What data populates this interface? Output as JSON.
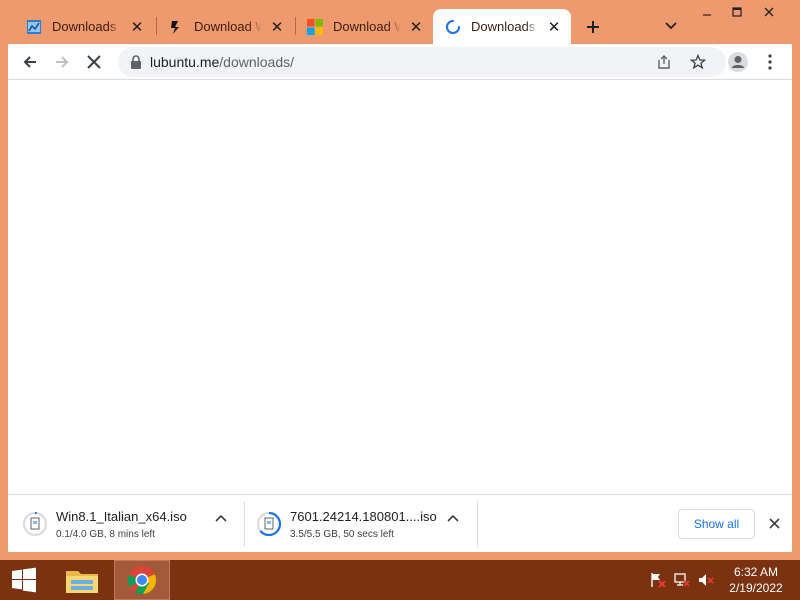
{
  "tabs": [
    {
      "title": "Downloads – ",
      "icon": "window-favicon",
      "active": false
    },
    {
      "title": "Download Wi",
      "icon": "download-favicon",
      "active": false
    },
    {
      "title": "Download Wi",
      "icon": "microsoft-favicon",
      "active": false
    },
    {
      "title": "Downloads – ",
      "icon": "loading-spinner",
      "active": true
    }
  ],
  "omnibox": {
    "host": "lubuntu.me",
    "path": "/downloads/"
  },
  "downloads": [
    {
      "name": "Win8.1_Italian_x64.iso",
      "status": "0.1/4.0 GB, 8 mins left",
      "progress": 0.025
    },
    {
      "name": "7601.24214.180801....iso",
      "status": "3.5/5.5 GB, 50 secs left",
      "progress": 0.64
    }
  ],
  "shelf": {
    "show_all": "Show all"
  },
  "clock": {
    "time": "6:32 AM",
    "date": "2/19/2022"
  },
  "colors": {
    "frame": "#EE9A6E",
    "taskbar": "#7A3210",
    "accent": "#1a73e8",
    "tab_active": "#ffffff"
  }
}
